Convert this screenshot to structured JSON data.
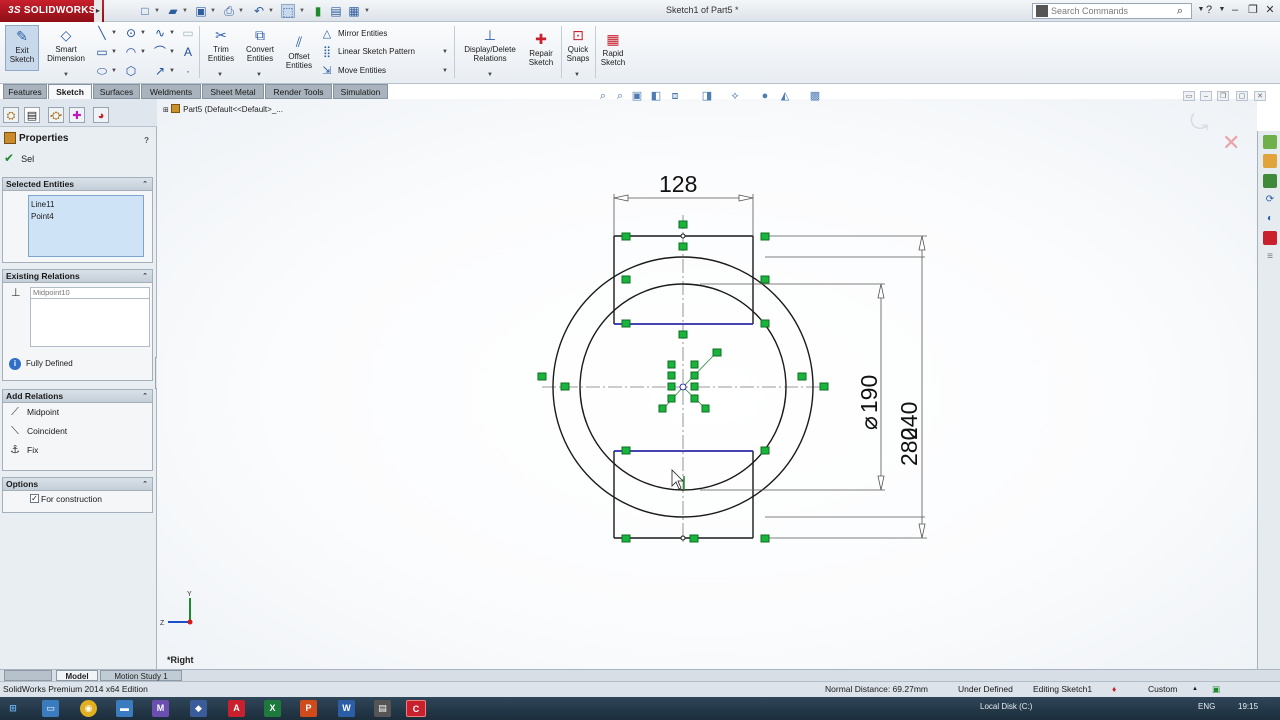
{
  "app": {
    "logo_text": "SOLIDWORKS",
    "logo_prefix": "3S",
    "document_title": "Sketch1 of Part5 *",
    "search_placeholder": "Search Commands"
  },
  "command_manager": {
    "exit_sketch": "Exit Sketch",
    "smart_dimension": "Smart Dimension",
    "trim_entities": "Trim Entities",
    "convert_entities": "Convert Entities",
    "offset_entities": "Offset Entities",
    "mirror_entities": "Mirror Entities",
    "linear_sketch_pattern": "Linear Sketch Pattern",
    "move_entities": "Move Entities",
    "display_delete_relations": "Display/Delete Relations",
    "repair_sketch": "Repair Sketch",
    "quick_snaps": "Quick Snaps",
    "rapid_sketch": "Rapid Sketch"
  },
  "tabs": [
    "Features",
    "Sketch",
    "Surfaces",
    "Weldments",
    "Sheet Metal",
    "Render Tools",
    "Simulation"
  ],
  "active_tab": "Sketch",
  "property_manager": {
    "title": "Properties",
    "ok_label": "Sel",
    "selected_entities": {
      "header": "Selected Entities",
      "items": [
        "Line11",
        "Point4"
      ]
    },
    "existing_relations": {
      "header": "Existing Relations",
      "field_value": "Midpoint10",
      "status": "Fully Defined"
    },
    "add_relations": {
      "header": "Add Relations",
      "items": [
        "Midpoint",
        "Coincident",
        "Fix"
      ]
    },
    "options": {
      "header": "Options",
      "for_construction_label": "For construction",
      "for_construction_checked": true
    }
  },
  "graphics": {
    "tree_label": "Part5 (Default<<Default>_...",
    "view_label": "*Right",
    "axis_y": "Y",
    "axis_z": "Z",
    "dimensions": {
      "width": "128",
      "diameter_prefix": "⌀",
      "diameter": "190",
      "outer": "240",
      "total": "280"
    }
  },
  "bottom_tabs": [
    "Model",
    "Motion Study 1"
  ],
  "active_bottom_tab": "Model",
  "status_bar": {
    "edition": "SolidWorks Premium 2014 x64 Edition",
    "normal_distance": "Normal Distance: 69.27mm",
    "definition": "Under Defined",
    "editing": "Editing Sketch1",
    "units": "Custom"
  },
  "taskbar": {
    "tray_drive": "Local Disk (C:)",
    "tray_lang": "ENG",
    "clock": "19:15"
  },
  "colors": {
    "logo_red": "#c8202c",
    "sketch_point": "#19b43c",
    "sketch_line_selected": "#2a2aa8",
    "sketch_line": "#1a1a1a"
  }
}
